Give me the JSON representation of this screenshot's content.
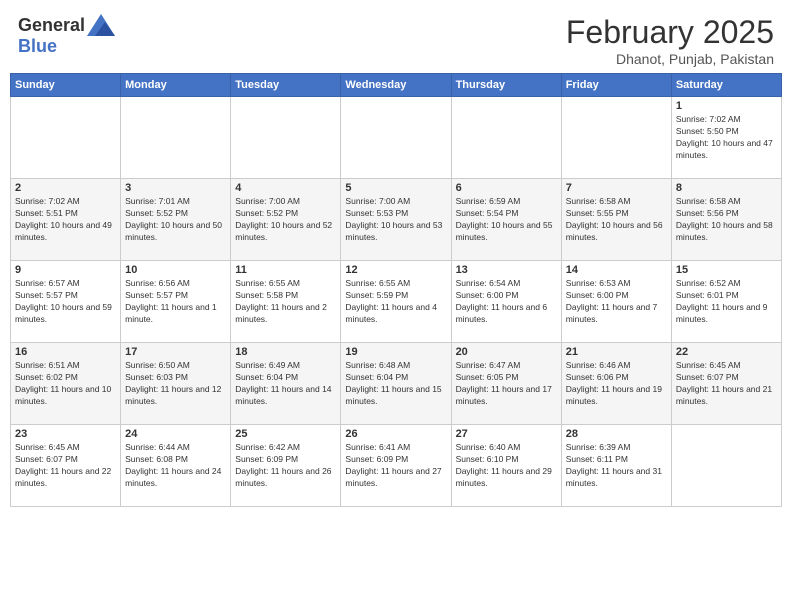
{
  "header": {
    "logo_general": "General",
    "logo_blue": "Blue",
    "month_title": "February 2025",
    "location": "Dhanot, Punjab, Pakistan"
  },
  "days_of_week": [
    "Sunday",
    "Monday",
    "Tuesday",
    "Wednesday",
    "Thursday",
    "Friday",
    "Saturday"
  ],
  "weeks": [
    [
      {
        "day": "",
        "info": ""
      },
      {
        "day": "",
        "info": ""
      },
      {
        "day": "",
        "info": ""
      },
      {
        "day": "",
        "info": ""
      },
      {
        "day": "",
        "info": ""
      },
      {
        "day": "",
        "info": ""
      },
      {
        "day": "1",
        "info": "Sunrise: 7:02 AM\nSunset: 5:50 PM\nDaylight: 10 hours and 47 minutes."
      }
    ],
    [
      {
        "day": "2",
        "info": "Sunrise: 7:02 AM\nSunset: 5:51 PM\nDaylight: 10 hours and 49 minutes."
      },
      {
        "day": "3",
        "info": "Sunrise: 7:01 AM\nSunset: 5:52 PM\nDaylight: 10 hours and 50 minutes."
      },
      {
        "day": "4",
        "info": "Sunrise: 7:00 AM\nSunset: 5:52 PM\nDaylight: 10 hours and 52 minutes."
      },
      {
        "day": "5",
        "info": "Sunrise: 7:00 AM\nSunset: 5:53 PM\nDaylight: 10 hours and 53 minutes."
      },
      {
        "day": "6",
        "info": "Sunrise: 6:59 AM\nSunset: 5:54 PM\nDaylight: 10 hours and 55 minutes."
      },
      {
        "day": "7",
        "info": "Sunrise: 6:58 AM\nSunset: 5:55 PM\nDaylight: 10 hours and 56 minutes."
      },
      {
        "day": "8",
        "info": "Sunrise: 6:58 AM\nSunset: 5:56 PM\nDaylight: 10 hours and 58 minutes."
      }
    ],
    [
      {
        "day": "9",
        "info": "Sunrise: 6:57 AM\nSunset: 5:57 PM\nDaylight: 10 hours and 59 minutes."
      },
      {
        "day": "10",
        "info": "Sunrise: 6:56 AM\nSunset: 5:57 PM\nDaylight: 11 hours and 1 minute."
      },
      {
        "day": "11",
        "info": "Sunrise: 6:55 AM\nSunset: 5:58 PM\nDaylight: 11 hours and 2 minutes."
      },
      {
        "day": "12",
        "info": "Sunrise: 6:55 AM\nSunset: 5:59 PM\nDaylight: 11 hours and 4 minutes."
      },
      {
        "day": "13",
        "info": "Sunrise: 6:54 AM\nSunset: 6:00 PM\nDaylight: 11 hours and 6 minutes."
      },
      {
        "day": "14",
        "info": "Sunrise: 6:53 AM\nSunset: 6:00 PM\nDaylight: 11 hours and 7 minutes."
      },
      {
        "day": "15",
        "info": "Sunrise: 6:52 AM\nSunset: 6:01 PM\nDaylight: 11 hours and 9 minutes."
      }
    ],
    [
      {
        "day": "16",
        "info": "Sunrise: 6:51 AM\nSunset: 6:02 PM\nDaylight: 11 hours and 10 minutes."
      },
      {
        "day": "17",
        "info": "Sunrise: 6:50 AM\nSunset: 6:03 PM\nDaylight: 11 hours and 12 minutes."
      },
      {
        "day": "18",
        "info": "Sunrise: 6:49 AM\nSunset: 6:04 PM\nDaylight: 11 hours and 14 minutes."
      },
      {
        "day": "19",
        "info": "Sunrise: 6:48 AM\nSunset: 6:04 PM\nDaylight: 11 hours and 15 minutes."
      },
      {
        "day": "20",
        "info": "Sunrise: 6:47 AM\nSunset: 6:05 PM\nDaylight: 11 hours and 17 minutes."
      },
      {
        "day": "21",
        "info": "Sunrise: 6:46 AM\nSunset: 6:06 PM\nDaylight: 11 hours and 19 minutes."
      },
      {
        "day": "22",
        "info": "Sunrise: 6:45 AM\nSunset: 6:07 PM\nDaylight: 11 hours and 21 minutes."
      }
    ],
    [
      {
        "day": "23",
        "info": "Sunrise: 6:45 AM\nSunset: 6:07 PM\nDaylight: 11 hours and 22 minutes."
      },
      {
        "day": "24",
        "info": "Sunrise: 6:44 AM\nSunset: 6:08 PM\nDaylight: 11 hours and 24 minutes."
      },
      {
        "day": "25",
        "info": "Sunrise: 6:42 AM\nSunset: 6:09 PM\nDaylight: 11 hours and 26 minutes."
      },
      {
        "day": "26",
        "info": "Sunrise: 6:41 AM\nSunset: 6:09 PM\nDaylight: 11 hours and 27 minutes."
      },
      {
        "day": "27",
        "info": "Sunrise: 6:40 AM\nSunset: 6:10 PM\nDaylight: 11 hours and 29 minutes."
      },
      {
        "day": "28",
        "info": "Sunrise: 6:39 AM\nSunset: 6:11 PM\nDaylight: 11 hours and 31 minutes."
      },
      {
        "day": "",
        "info": ""
      }
    ]
  ]
}
